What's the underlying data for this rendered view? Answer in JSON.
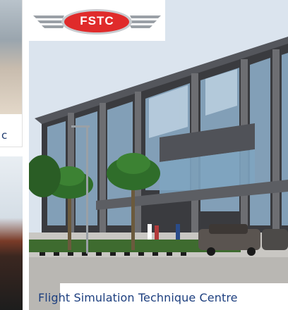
{
  "logo": {
    "text": "FSTC",
    "accent": "#e02b2b"
  },
  "left_cards": [
    {
      "caption": "c"
    }
  ],
  "main": {
    "caption": "Flight Simulation Technique Centre"
  },
  "colors": {
    "caption_text": "#1d3f7f",
    "building_glass": "#8fb1cc"
  }
}
